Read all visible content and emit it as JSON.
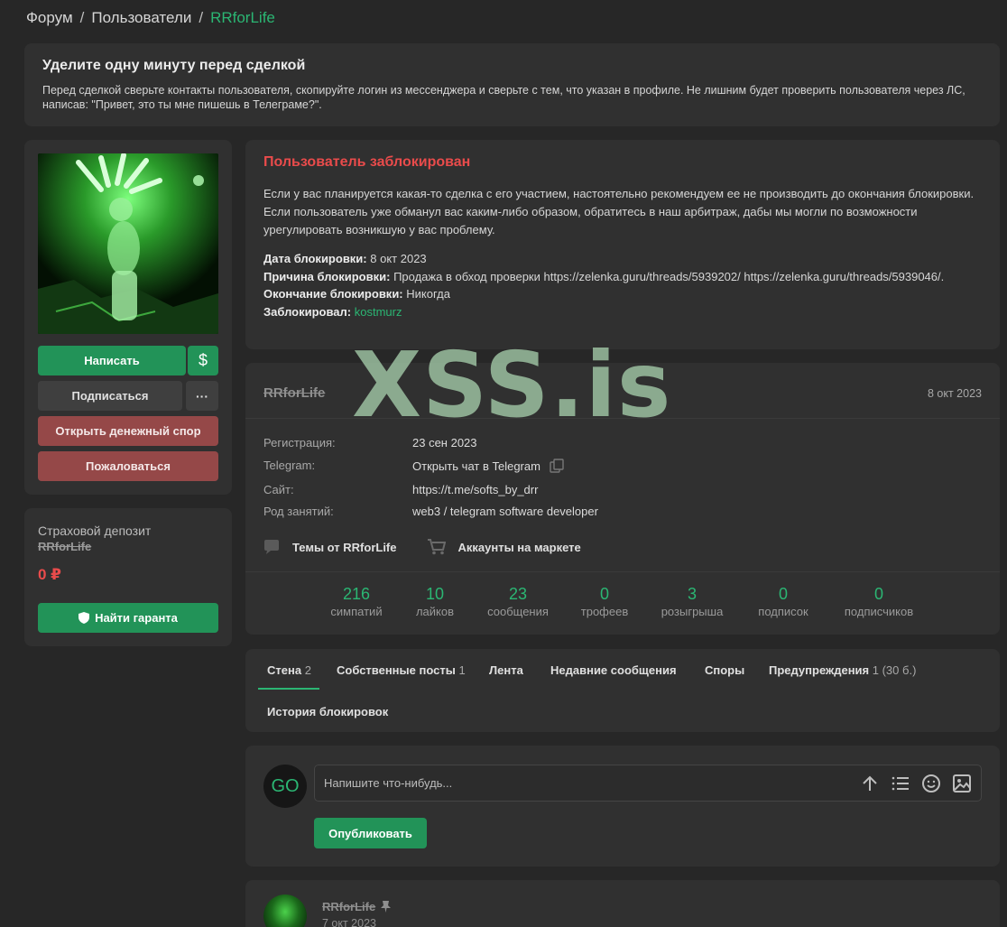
{
  "breadcrumb": {
    "forum": "Форум",
    "users": "Пользователи",
    "current": "RRforLife",
    "sep": "/"
  },
  "notice": {
    "title": "Уделите одну минуту перед сделкой",
    "text": "Перед сделкой сверьте контакты пользователя, скопируйте логин из мессенджера и сверьте с тем, что указан в профиле. Не лишним будет проверить пользователя через ЛС, написав: \"Привет, это ты мне пишешь в Телеграме?\"."
  },
  "sidebar": {
    "write_label": "Написать",
    "dollar_label": "$",
    "subscribe_label": "Подписаться",
    "more_label": "···",
    "dispute_label": "Открыть денежный спор",
    "report_label": "Пожаловаться"
  },
  "deposit": {
    "title": "Страховой депозит",
    "user": "RRforLife",
    "amount": "0 ₽",
    "guarantor_label": "Найти гаранта"
  },
  "ban": {
    "title": "Пользователь заблокирован",
    "text": "Если у вас планируется какая-то сделка с его участием, настоятельно рекомендуем ее не производить до окончания блокировки. Если пользователь уже обманул вас каким-либо образом, обратитесь в наш арбитраж, дабы мы могли по возможности урегулировать возникшую у вас проблему.",
    "date_label": "Дата блокировки:",
    "date_value": "8 окт 2023",
    "reason_label": "Причина блокировки:",
    "reason_value": "Продажа в обход проверки https://zelenka.guru/threads/5939202/ https://zelenka.guru/threads/5939046/.",
    "end_label": "Окончание блокировки:",
    "end_value": "Никогда",
    "by_label": "Заблокировал:",
    "by_value": "kostmurz"
  },
  "profile": {
    "name": "RRforLife",
    "date": "8 окт 2023",
    "rows": [
      {
        "key": "Регистрация:",
        "value": "23 сен 2023"
      },
      {
        "key": "Telegram:",
        "value": "Открыть чат в Telegram"
      },
      {
        "key": "Сайт:",
        "value": "https://t.me/softs_by_drr"
      },
      {
        "key": "Род занятий:",
        "value": "web3 / telegram software developer"
      }
    ],
    "threads_label": "Темы от RRforLife",
    "market_label": "Аккаунты на маркете",
    "stats": [
      {
        "n": "216",
        "l": "симпатий"
      },
      {
        "n": "10",
        "l": "лайков"
      },
      {
        "n": "23",
        "l": "сообщения"
      },
      {
        "n": "0",
        "l": "трофеев"
      },
      {
        "n": "3",
        "l": "розыгрыша"
      },
      {
        "n": "0",
        "l": "подписок"
      },
      {
        "n": "0",
        "l": "подписчиков"
      }
    ]
  },
  "tabs": [
    {
      "label": "Стена",
      "count": "2"
    },
    {
      "label": "Собственные посты",
      "count": "1"
    },
    {
      "label": "Лента",
      "count": ""
    },
    {
      "label": "Недавние сообщения",
      "count": ""
    },
    {
      "label": "Споры",
      "count": ""
    },
    {
      "label": "Предупреждения",
      "count": "1 (30 б.)"
    },
    {
      "label": "История блокировок",
      "count": ""
    }
  ],
  "composer": {
    "avatar_text": "GO",
    "placeholder": "Напишите что-нибудь...",
    "publish_label": "Опубликовать"
  },
  "wall_post": {
    "author": "RRforLife",
    "date": "7 окт 2023"
  },
  "watermark": "XSS.is",
  "colors": {
    "accent": "#2bb673",
    "button_green": "#229358",
    "danger": "#e94b4b",
    "button_red": "#954848"
  }
}
